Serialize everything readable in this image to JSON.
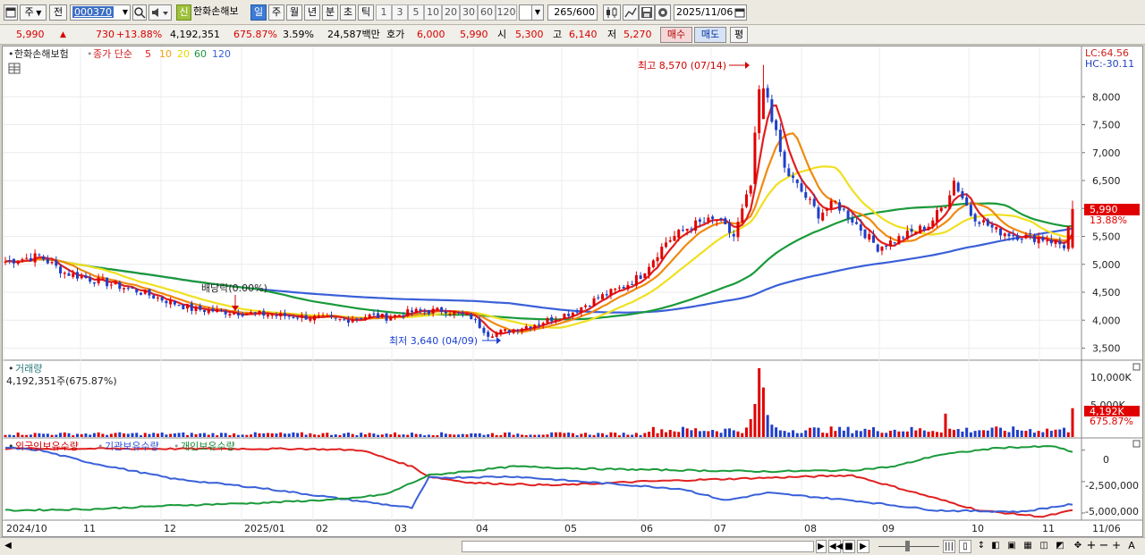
{
  "toolbar": {
    "period_main": "주",
    "prev_label": "전",
    "stock_code": "000370",
    "badge": "신",
    "stock_name": "한화손해보",
    "periods": [
      "일",
      "주",
      "월",
      "년",
      "분",
      "초",
      "틱"
    ],
    "minutes": [
      "1",
      "3",
      "5",
      "10",
      "20",
      "30",
      "60",
      "120"
    ],
    "count": "265",
    "count_total": "/600",
    "date": "2025/11/06"
  },
  "quote": {
    "price": "5,990",
    "change": "730",
    "change_pct": "+13.88%",
    "volume": "4,192,351",
    "volume_ratio": "675.87%",
    "turnover": "3.59%",
    "amount": "24,587백만",
    "hoga_label": "호가",
    "ask": "6,000",
    "bid": "5,990",
    "open_label": "시",
    "open": "5,300",
    "high_label": "고",
    "high": "6,140",
    "low_label": "저",
    "low": "5,270",
    "buy_label": "매수",
    "sell_label": "매도",
    "avg_label": "평"
  },
  "legend": {
    "name": "한화손해보험",
    "ma_label": "종가 단순",
    "ma_periods": [
      "5",
      "10",
      "20",
      "60",
      "120"
    ],
    "lc": "LC:64.56",
    "hc": "HC:-30.11"
  },
  "annotations": {
    "high": "최고 8,570 (07/14)",
    "low": "최저 3,640 (04/09)",
    "dividend": "배당락(0.00%)",
    "price_tag": "5,990",
    "pct_tag": "13.88%"
  },
  "volume_panel": {
    "title": "거래량",
    "value": "4,192,351주(675.87%)",
    "scale_top": "10,000K",
    "scale_mid": "5,000K",
    "tag_value": "4,192K",
    "tag_pct": "675.87%"
  },
  "holdings_panel": {
    "series_labels": [
      "외국인보유수량",
      "기관보유수량",
      "개인보유수량"
    ],
    "scale": [
      "0",
      "-2,500,000",
      "-5,000,000"
    ]
  },
  "colors": {
    "up": "#e00000",
    "down": "#1f3fc8",
    "ma5": "#e02020",
    "ma10": "#f08a10",
    "ma20": "#f0e020",
    "ma60": "#1a9a3a",
    "ma120": "#3a60d8"
  },
  "chart_data": {
    "type": "candlestick",
    "title": "한화손해보험",
    "y_axis_ticks": [
      3500,
      4000,
      4500,
      5000,
      5500,
      6000,
      6500,
      7000,
      7500,
      8000
    ],
    "y_axis_labels": [
      "3,500",
      "4,000",
      "4,500",
      "5,000",
      "5,500",
      "6,000",
      "6,500",
      "7,000",
      "7,500",
      "8,000"
    ],
    "ylim": [
      3300,
      8900
    ],
    "x_labels": [
      "2024/10",
      "11",
      "12",
      "2025/01",
      "02",
      "03",
      "04",
      "05",
      "06",
      "07",
      "08",
      "09",
      "10",
      "11",
      "11/06"
    ],
    "close_keypoints": [
      [
        0,
        5050
      ],
      [
        8,
        5150
      ],
      [
        14,
        4850
      ],
      [
        22,
        4700
      ],
      [
        30,
        4550
      ],
      [
        36,
        4400
      ],
      [
        44,
        4200
      ],
      [
        52,
        4150
      ],
      [
        62,
        4100
      ],
      [
        72,
        4050
      ],
      [
        80,
        4000
      ],
      [
        86,
        4080
      ],
      [
        90,
        4050
      ],
      [
        96,
        4150
      ],
      [
        104,
        4180
      ],
      [
        110,
        4050
      ],
      [
        114,
        3750
      ],
      [
        118,
        3800
      ],
      [
        126,
        3950
      ],
      [
        134,
        4150
      ],
      [
        140,
        4400
      ],
      [
        146,
        4600
      ],
      [
        150,
        4800
      ],
      [
        156,
        5400
      ],
      [
        162,
        5700
      ],
      [
        168,
        5800
      ],
      [
        172,
        5500
      ],
      [
        176,
        6400
      ],
      [
        178,
        8100
      ],
      [
        180,
        8000
      ],
      [
        182,
        7300
      ],
      [
        184,
        6700
      ],
      [
        188,
        6300
      ],
      [
        192,
        5900
      ],
      [
        196,
        6100
      ],
      [
        200,
        5800
      ],
      [
        206,
        5300
      ],
      [
        212,
        5500
      ],
      [
        218,
        5700
      ],
      [
        222,
        6100
      ],
      [
        224,
        6500
      ],
      [
        228,
        5900
      ],
      [
        234,
        5600
      ],
      [
        240,
        5500
      ],
      [
        246,
        5450
      ],
      [
        250,
        5330
      ],
      [
        252,
        5990
      ]
    ],
    "high": {
      "value": 8570,
      "date": "07/14"
    },
    "low": {
      "value": 3640,
      "date": "04/09"
    },
    "last": {
      "close": 5990,
      "open": 5300,
      "high": 6140,
      "low": 5270,
      "volume": 4192351
    },
    "moving_averages": [
      5,
      10,
      20,
      60,
      120
    ],
    "volume_ylim": [
      0,
      10000000
    ],
    "holdings_ylim": [
      -5500000,
      900000
    ],
    "holdings_series": [
      {
        "name": "외국인보유수량",
        "keypoints": [
          [
            0,
            120000
          ],
          [
            70,
            100000
          ],
          [
            84,
            0
          ],
          [
            96,
            -1300000
          ],
          [
            100,
            -2100000
          ],
          [
            110,
            -2600000
          ],
          [
            130,
            -2800000
          ],
          [
            150,
            -2500000
          ],
          [
            170,
            -2300000
          ],
          [
            200,
            -2000000
          ],
          [
            230,
            -4800000
          ],
          [
            245,
            -5300000
          ],
          [
            252,
            -4800000
          ]
        ]
      },
      {
        "name": "기관보유수량",
        "keypoints": [
          [
            0,
            200000
          ],
          [
            8,
            0
          ],
          [
            20,
            -1000000
          ],
          [
            40,
            -2300000
          ],
          [
            60,
            -3000000
          ],
          [
            80,
            -3900000
          ],
          [
            96,
            -4600000
          ],
          [
            100,
            -2200000
          ],
          [
            120,
            -2100000
          ],
          [
            140,
            -2600000
          ],
          [
            160,
            -3100000
          ],
          [
            170,
            -4000000
          ],
          [
            180,
            -3400000
          ],
          [
            200,
            -4000000
          ],
          [
            220,
            -4800000
          ],
          [
            240,
            -4900000
          ],
          [
            252,
            -4300000
          ]
        ]
      },
      {
        "name": "개인보유수량",
        "keypoints": [
          [
            0,
            -4800000
          ],
          [
            20,
            -4700000
          ],
          [
            40,
            -4400000
          ],
          [
            60,
            -4200000
          ],
          [
            80,
            -3900000
          ],
          [
            90,
            -3500000
          ],
          [
            100,
            -2000000
          ],
          [
            120,
            -1300000
          ],
          [
            140,
            -1500000
          ],
          [
            160,
            -1600000
          ],
          [
            180,
            -1700000
          ],
          [
            200,
            -1600000
          ],
          [
            210,
            -1300000
          ],
          [
            220,
            -400000
          ],
          [
            235,
            200000
          ],
          [
            248,
            300000
          ],
          [
            252,
            -200000
          ]
        ]
      }
    ]
  }
}
